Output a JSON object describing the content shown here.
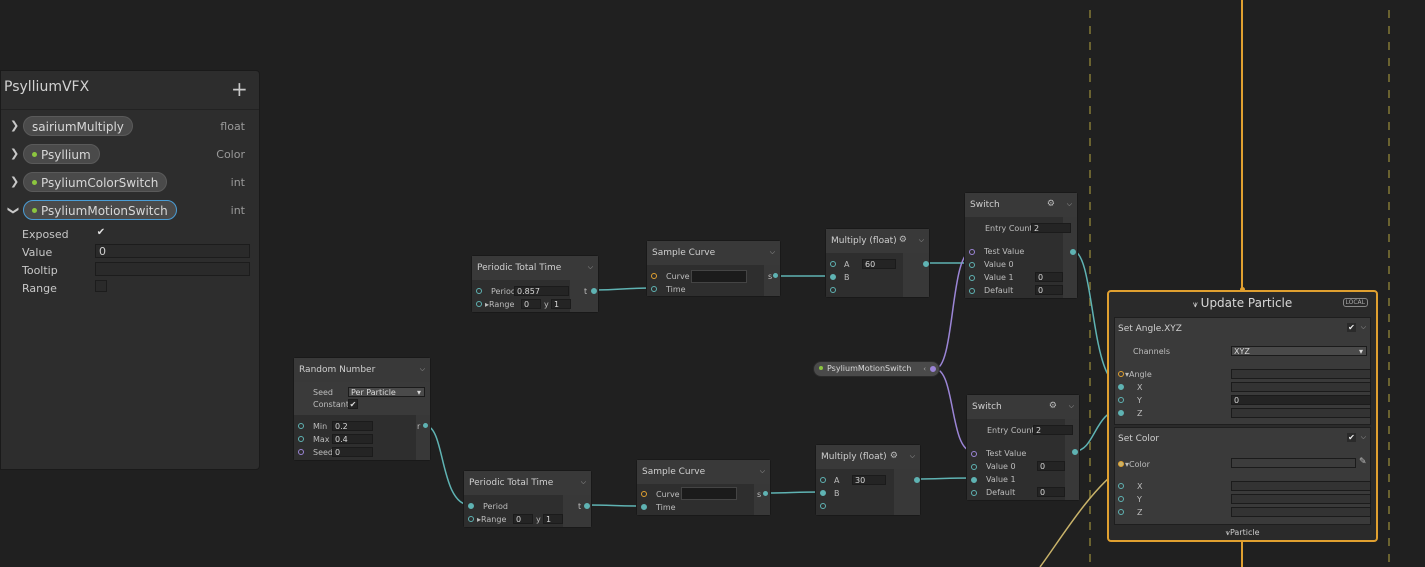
{
  "blackboard": {
    "title": "PsylliumVFX",
    "add_icon": "+",
    "properties": [
      {
        "name": "sairiumMultiply",
        "type": "float",
        "exposed": false,
        "expanded": false
      },
      {
        "name": "Psyllium",
        "type": "Color",
        "exposed": true,
        "expanded": false
      },
      {
        "name": "PsyliumColorSwitch",
        "type": "int",
        "exposed": true,
        "expanded": false
      },
      {
        "name": "PsyliumMotionSwitch",
        "type": "int",
        "exposed": true,
        "expanded": true,
        "selected": true
      }
    ],
    "details": {
      "exposed_label": "Exposed",
      "exposed_checked": true,
      "value_label": "Value",
      "value": "0",
      "tooltip_label": "Tooltip",
      "tooltip": "",
      "range_label": "Range",
      "range_checked": false
    }
  },
  "nodes": {
    "periodic1": {
      "title": "Periodic Total Time",
      "period_label": "Period",
      "period": "0.857",
      "range_label": "Range",
      "rx_label": "x",
      "rx": "0",
      "ry_label": "y",
      "ry": "1",
      "out": "t"
    },
    "sample1": {
      "title": "Sample Curve",
      "curve_label": "Curve",
      "time_label": "Time",
      "out": "s"
    },
    "multiply1": {
      "title": "Multiply (float)",
      "a_label": "A",
      "a": "60",
      "b_label": "B"
    },
    "switch1": {
      "title": "Switch",
      "entry_label": "Entry Count",
      "entry": "2",
      "test_label": "Test Value",
      "v0_label": "Value 0",
      "v1_label": "Value 1",
      "v1": "0",
      "def_label": "Default",
      "def": "0"
    },
    "random": {
      "title": "Random Number",
      "seed_label": "Seed",
      "seed_mode": "Per Particle",
      "constant_label": "Constant",
      "min_label": "Min",
      "min": "0.2",
      "max_label": "Max",
      "max": "0.4",
      "seed2_label": "Seed",
      "seed2": "0",
      "out": "r"
    },
    "periodic2": {
      "title": "Periodic Total Time",
      "period_label": "Period",
      "range_label": "Range",
      "rx_label": "x",
      "rx": "0",
      "ry_label": "y",
      "ry": "1",
      "out": "t"
    },
    "sample2": {
      "title": "Sample Curve",
      "curve_label": "Curve",
      "time_label": "Time",
      "out": "s"
    },
    "multiply2": {
      "title": "Multiply (float)",
      "a_label": "A",
      "a": "30",
      "b_label": "B"
    },
    "switch2": {
      "title": "Switch",
      "entry_label": "Entry Count",
      "entry": "2",
      "test_label": "Test Value",
      "v0_label": "Value 0",
      "v0": "0",
      "v1_label": "Value 1",
      "v1": "0",
      "def_label": "Default",
      "def": "0"
    }
  },
  "parameter_node": {
    "label": "PsyliumMotionSwitch"
  },
  "context": {
    "title": "Update Particle",
    "local_badge": "LOCAL",
    "footer": "Particle",
    "blocks": [
      {
        "title": "Set Angle.XYZ",
        "channels_label": "Channels",
        "channels": "XYZ",
        "angle_label": "Angle",
        "x": "X",
        "y": "Y",
        "y_value": "0",
        "z": "Z"
      },
      {
        "title": "Set Color",
        "color_label": "Color",
        "x": "X",
        "y": "Y",
        "z": "Z"
      }
    ]
  },
  "colors": {
    "accent_context": "#e0a030",
    "wire_float": "#5fb3b3",
    "wire_int": "#9b85d6",
    "exposed_dot": "#8cc63f",
    "selection": "#4a9dd6"
  }
}
